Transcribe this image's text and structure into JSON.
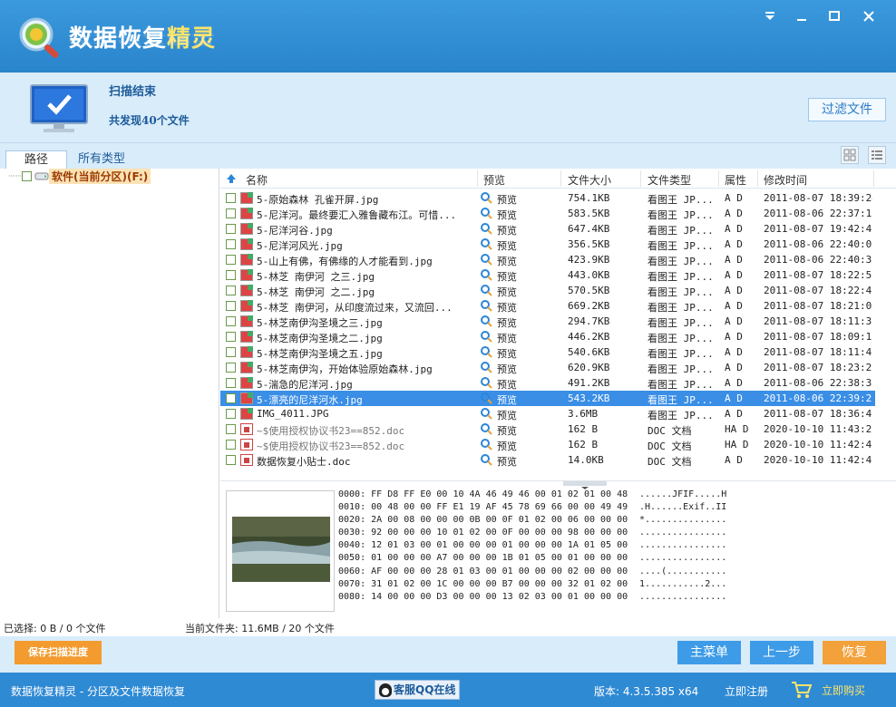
{
  "window": {
    "title_main": "数据恢复",
    "title_highlight": "精灵",
    "controls": [
      "menu-icon",
      "minimize-icon",
      "maximize-icon",
      "close-icon"
    ]
  },
  "status": {
    "title": "扫描结束",
    "found": "共发现40个文件",
    "filter_button": "过滤文件"
  },
  "tabs": {
    "path": "路径",
    "types": "所有类型"
  },
  "tree": {
    "root_label": "软件(当前分区)(F:)"
  },
  "columns": [
    "名称",
    "预览",
    "文件大小",
    "文件类型",
    "属性",
    "修改时间"
  ],
  "files": [
    {
      "name": "5-原始森林 孔雀开屏.jpg",
      "preview": "预览",
      "size": "754.1KB",
      "type": "看图王 JP...",
      "attr": "A D",
      "mtime": "2011-08-07 18:39:24",
      "icon": "img"
    },
    {
      "name": "5-尼洋河。最终要汇入雅鲁藏布江。可惜...",
      "preview": "预览",
      "size": "583.5KB",
      "type": "看图王 JP...",
      "attr": "A D",
      "mtime": "2011-08-06 22:37:19",
      "icon": "img"
    },
    {
      "name": "5-尼洋河谷.jpg",
      "preview": "预览",
      "size": "647.4KB",
      "type": "看图王 JP...",
      "attr": "A D",
      "mtime": "2011-08-07 19:42:41",
      "icon": "img"
    },
    {
      "name": "5-尼洋河风光.jpg",
      "preview": "预览",
      "size": "356.5KB",
      "type": "看图王 JP...",
      "attr": "A D",
      "mtime": "2011-08-06 22:40:08",
      "icon": "img"
    },
    {
      "name": "5-山上有佛，有佛缘的人才能看到.jpg",
      "preview": "预览",
      "size": "423.9KB",
      "type": "看图王 JP...",
      "attr": "A D",
      "mtime": "2011-08-06 22:40:39",
      "icon": "img"
    },
    {
      "name": "5-林芝 南伊河 之三.jpg",
      "preview": "预览",
      "size": "443.0KB",
      "type": "看图王 JP...",
      "attr": "A D",
      "mtime": "2011-08-07 18:22:50",
      "icon": "img"
    },
    {
      "name": "5-林芝 南伊河 之二.jpg",
      "preview": "预览",
      "size": "570.5KB",
      "type": "看图王 JP...",
      "attr": "A D",
      "mtime": "2011-08-07 18:22:46",
      "icon": "img"
    },
    {
      "name": "5-林芝 南伊河，从印度流过来，又流回...",
      "preview": "预览",
      "size": "669.2KB",
      "type": "看图王 JP...",
      "attr": "A D",
      "mtime": "2011-08-07 18:21:04",
      "icon": "img"
    },
    {
      "name": "5-林芝南伊沟圣境之三.jpg",
      "preview": "预览",
      "size": "294.7KB",
      "type": "看图王 JP...",
      "attr": "A D",
      "mtime": "2011-08-07 18:11:36",
      "icon": "img"
    },
    {
      "name": "5-林芝南伊沟圣境之二.jpg",
      "preview": "预览",
      "size": "446.2KB",
      "type": "看图王 JP...",
      "attr": "A D",
      "mtime": "2011-08-07 18:09:12",
      "icon": "img"
    },
    {
      "name": "5-林芝南伊沟圣境之五.jpg",
      "preview": "预览",
      "size": "540.6KB",
      "type": "看图王 JP...",
      "attr": "A D",
      "mtime": "2011-08-07 18:11:48",
      "icon": "img"
    },
    {
      "name": "5-林芝南伊沟，开始体验原始森林.jpg",
      "preview": "预览",
      "size": "620.9KB",
      "type": "看图王 JP...",
      "attr": "A D",
      "mtime": "2011-08-07 18:23:23",
      "icon": "img"
    },
    {
      "name": "5-湍急的尼洋河.jpg",
      "preview": "预览",
      "size": "491.2KB",
      "type": "看图王 JP...",
      "attr": "A D",
      "mtime": "2011-08-06 22:38:31",
      "icon": "img"
    },
    {
      "name": "5-漂亮的尼洋河水.jpg",
      "preview": "预览",
      "size": "543.2KB",
      "type": "看图王 JP...",
      "attr": "A D",
      "mtime": "2011-08-06 22:39:23",
      "icon": "img",
      "selected": true
    },
    {
      "name": "IMG_4011.JPG",
      "preview": "预览",
      "size": "3.6MB",
      "type": "看图王 JP...",
      "attr": "A D",
      "mtime": "2011-08-07 18:36:42",
      "icon": "img"
    },
    {
      "name": "~$使用授权协议书23==852.doc",
      "preview": "预览",
      "size": "162 B",
      "type": "DOC 文档",
      "attr": "HA D",
      "mtime": "2020-10-10 11:43:26",
      "icon": "doc",
      "deleted": true
    },
    {
      "name": "~$使用授权协议书23==852.doc",
      "preview": "预览",
      "size": "162 B",
      "type": "DOC 文档",
      "attr": "HA D",
      "mtime": "2020-10-10 11:42:45",
      "icon": "doc",
      "deleted": true
    },
    {
      "name": "数据恢复小贴士.doc",
      "preview": "预览",
      "size": "14.0KB",
      "type": "DOC 文档",
      "attr": "A D",
      "mtime": "2020-10-10 11:42:47",
      "icon": "doc"
    }
  ],
  "hex": [
    {
      "addr": "0000:",
      "bytes": "FF D8 FF E0 00 10 4A 46 49 46 00 01 02 01 00 48",
      "ascii": "......JFIF.....H"
    },
    {
      "addr": "0010:",
      "bytes": "00 48 00 00 FF E1 19 AF 45 78 69 66 00 00 49 49",
      "ascii": ".H......Exif..II"
    },
    {
      "addr": "0020:",
      "bytes": "2A 00 08 00 00 00 0B 00 0F 01 02 00 06 00 00 00",
      "ascii": "*..............."
    },
    {
      "addr": "0030:",
      "bytes": "92 00 00 00 10 01 02 00 0F 00 00 00 98 00 00 00",
      "ascii": "................"
    },
    {
      "addr": "0040:",
      "bytes": "12 01 03 00 01 00 00 00 01 00 00 00 1A 01 05 00",
      "ascii": "................"
    },
    {
      "addr": "0050:",
      "bytes": "01 00 00 00 A7 00 00 00 1B 01 05 00 01 00 00 00",
      "ascii": "................"
    },
    {
      "addr": "0060:",
      "bytes": "AF 00 00 00 28 01 03 00 01 00 00 00 02 00 00 00",
      "ascii": "....(..........."
    },
    {
      "addr": "0070:",
      "bytes": "31 01 02 00 1C 00 00 00 B7 00 00 00 32 01 02 00",
      "ascii": "1...........2..."
    },
    {
      "addr": "0080:",
      "bytes": "14 00 00 00 D3 00 00 00 13 02 03 00 01 00 00 00",
      "ascii": "................"
    }
  ],
  "info": {
    "selected": "已选择: 0 B / 0 个文件",
    "current_folder": "当前文件夹: 11.6MB / 20 个文件"
  },
  "buttons": {
    "save_progress": "保存扫描进度",
    "main_menu": "主菜单",
    "prev_step": "上一步",
    "recover": "恢复"
  },
  "footer": {
    "app_desc": "数据恢复精灵 - 分区及文件数据恢复",
    "qq": "客服QQ在线",
    "version": "版本: 4.3.5.385 x64",
    "register": "立即注册",
    "buy": "立即购买"
  },
  "colors": {
    "title_bar": "#2a85cc",
    "selection": "#3a8ee6",
    "accent_orange": "#f39b2f",
    "accent_blue": "#3d9be8"
  }
}
